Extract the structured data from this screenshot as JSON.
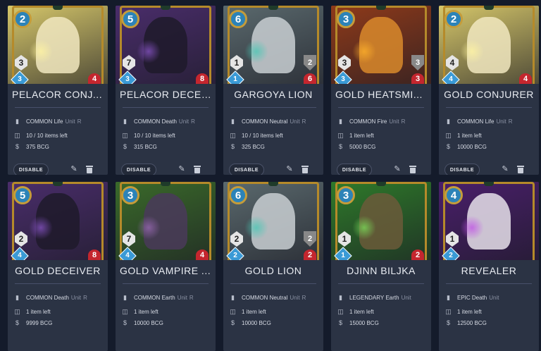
{
  "cards": [
    {
      "name": "PELACOR CONJ...",
      "mana": "2",
      "attack": "3",
      "armor": "",
      "speed": "3",
      "health": "4",
      "rarity": "COMMON",
      "element": "Life",
      "type": "Unit",
      "r": "R",
      "stock": "10 / 10 items left",
      "price": "375 BCG",
      "disable_label": "DISABLE",
      "bg": "#d6c76a",
      "figure": "#f1e8c0",
      "glow": "#fff4a1",
      "title_align": "left"
    },
    {
      "name": "PELACOR DECEI...",
      "mana": "5",
      "attack": "7",
      "armor": "",
      "speed": "3",
      "health": "8",
      "rarity": "COMMON",
      "element": "Death",
      "type": "Unit",
      "r": "R",
      "stock": "10 / 10 items left",
      "price": "315 BCG",
      "disable_label": "DISABLE",
      "bg": "#4a2d6b",
      "figure": "#1f1a2a",
      "glow": "#8a55c9",
      "title_align": "left"
    },
    {
      "name": "GARGOYA LION",
      "mana": "6",
      "attack": "1",
      "armor": "2",
      "speed": "1",
      "health": "6",
      "rarity": "COMMON",
      "element": "Neutral",
      "type": "Unit",
      "r": "R",
      "stock": "10 / 10 items left",
      "price": "325 BCG",
      "disable_label": "DISABLE",
      "bg": "#5b6a6e",
      "figure": "#c9cfd2",
      "glow": "#46c8b5",
      "title_align": "center"
    },
    {
      "name": "GOLD HEATSMI...",
      "mana": "3",
      "attack": "3",
      "armor": "3",
      "speed": "3",
      "health": "3",
      "rarity": "COMMON",
      "element": "Fire",
      "type": "Unit",
      "r": "R",
      "stock": "1 item left",
      "price": "5000 BCG",
      "disable_label": "DISABLE",
      "bg": "#8f3a1a",
      "figure": "#d98a2b",
      "glow": "#ffb12b",
      "title_align": "left"
    },
    {
      "name": "GOLD CONJURER",
      "mana": "2",
      "attack": "4",
      "armor": "",
      "speed": "4",
      "health": "4",
      "rarity": "COMMON",
      "element": "Life",
      "type": "Unit",
      "r": "R",
      "stock": "1 item left",
      "price": "10000 BCG",
      "disable_label": "DISABLE",
      "bg": "#d6c76a",
      "figure": "#f1e8c0",
      "glow": "#fff4a1",
      "title_align": "center"
    },
    {
      "name": "GOLD DECEIVER",
      "mana": "5",
      "attack": "2",
      "armor": "",
      "speed": "4",
      "health": "8",
      "rarity": "COMMON",
      "element": "Death",
      "type": "Unit",
      "r": "R",
      "stock": "1 item left",
      "price": "9999 BCG",
      "disable_label": "",
      "bg": "#4a2d6b",
      "figure": "#1f1a2a",
      "glow": "#8a55c9",
      "title_align": "center"
    },
    {
      "name": "GOLD VAMPIRE ...",
      "mana": "3",
      "attack": "7",
      "armor": "",
      "speed": "4",
      "health": "4",
      "rarity": "COMMON",
      "element": "Earth",
      "type": "Unit",
      "r": "R",
      "stock": "1 item left",
      "price": "10000 BCG",
      "disable_label": "",
      "bg": "#3a6a2a",
      "figure": "#4a3a5a",
      "glow": "#9a6ab5",
      "title_align": "left"
    },
    {
      "name": "GOLD LION",
      "mana": "6",
      "attack": "2",
      "armor": "2",
      "speed": "2",
      "health": "2",
      "rarity": "COMMON",
      "element": "Neutral",
      "type": "Unit",
      "r": "R",
      "stock": "1 item left",
      "price": "10000 BCG",
      "disable_label": "",
      "bg": "#5b6a6e",
      "figure": "#c9cfd2",
      "glow": "#46c8b5",
      "title_align": "center"
    },
    {
      "name": "DJINN BILJKA",
      "mana": "3",
      "attack": "1",
      "armor": "",
      "speed": "1",
      "health": "2",
      "rarity": "LEGENDARY",
      "element": "Earth",
      "type": "Unit",
      "r": "",
      "stock": "1 item left",
      "price": "15000 BCG",
      "disable_label": "",
      "bg": "#2e7a2a",
      "figure": "#6b5a3a",
      "glow": "#7be05a",
      "title_align": "center"
    },
    {
      "name": "REVEALER",
      "mana": "4",
      "attack": "1",
      "armor": "",
      "speed": "2",
      "health": "",
      "rarity": "EPIC",
      "element": "Death",
      "type": "Unit",
      "r": "",
      "stock": "1 item left",
      "price": "12500 BCG",
      "disable_label": "",
      "bg": "#4a1f6b",
      "figure": "#e6e0ea",
      "glow": "#c04fe6",
      "title_align": "center"
    }
  ]
}
